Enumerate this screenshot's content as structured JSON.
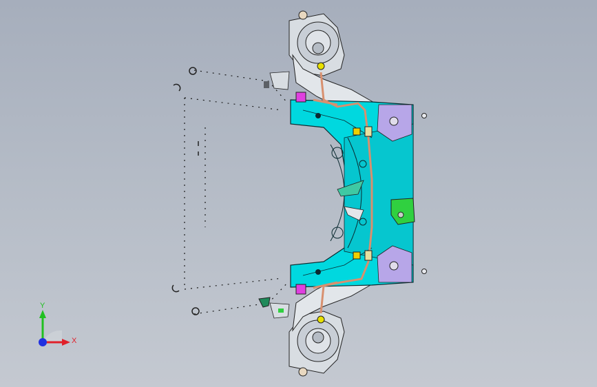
{
  "viewport": {
    "background_top": "#a6aebc",
    "background_bottom": "#c4c9d1"
  },
  "model": {
    "frame_color": "#00d8df",
    "frame_edge": "#0a2a30",
    "pipe_color": "#d8906f",
    "bushing_color": "#e040e0",
    "bracket_green": "#30d040",
    "plate_lavender": "#b7a6e8",
    "marker_yellow": "#f0d000",
    "top_mount_color": "#d8dde2"
  },
  "triad": {
    "x_label": "X",
    "y_label": "Y",
    "x_color": "#e0202a",
    "y_color": "#20c020",
    "z_color": "#2030e0"
  }
}
